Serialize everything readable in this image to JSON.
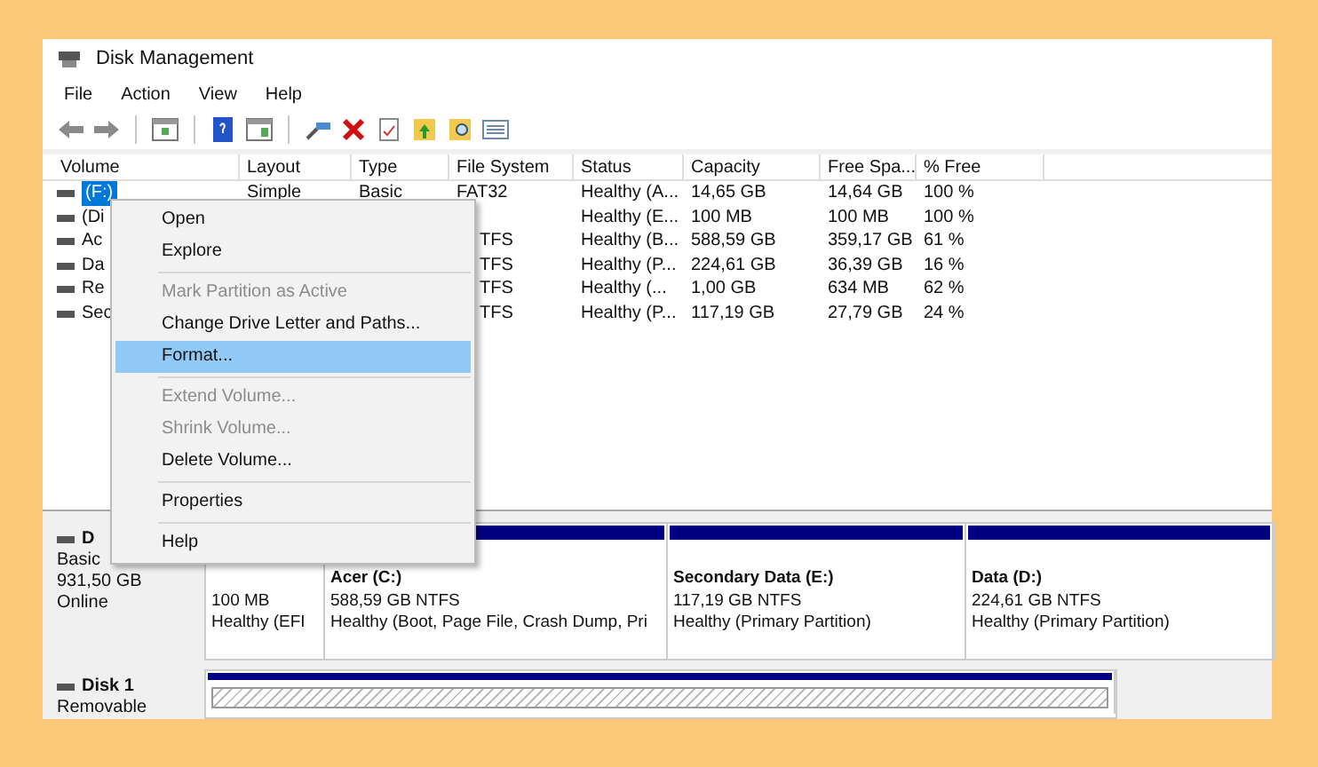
{
  "window": {
    "title": "Disk Management"
  },
  "menu_bar": [
    "File",
    "Action",
    "View",
    "Help"
  ],
  "table": {
    "columns": [
      "Volume",
      "Layout",
      "Type",
      "File System",
      "Status",
      "Capacity",
      "Free Spa...",
      "% Free"
    ],
    "rows": [
      {
        "selected": true,
        "cells": [
          "(F:)",
          "Simple",
          "Basic",
          "FAT32",
          "Healthy (A...",
          "14,65 GB",
          "14,64 GB",
          "100 %"
        ]
      },
      {
        "selected": false,
        "cells": [
          "(Di",
          "",
          "",
          "",
          "Healthy (E...",
          "100 MB",
          "100 MB",
          "100 %"
        ]
      },
      {
        "selected": false,
        "cells": [
          "Ac",
          "",
          "",
          "TFS",
          "Healthy (B...",
          "588,59 GB",
          "359,17 GB",
          "61 %"
        ]
      },
      {
        "selected": false,
        "cells": [
          "Da",
          "",
          "",
          "TFS",
          "Healthy (P...",
          "224,61 GB",
          "36,39 GB",
          "16 %"
        ]
      },
      {
        "selected": false,
        "cells": [
          "Re",
          "",
          "",
          "TFS",
          "Healthy (...",
          "1,00 GB",
          "634 MB",
          "62 %"
        ]
      },
      {
        "selected": false,
        "cells": [
          "Sec",
          "",
          "",
          "TFS",
          "Healthy (P...",
          "117,19 GB",
          "27,79 GB",
          "24 %"
        ]
      }
    ]
  },
  "context_menu": [
    {
      "kind": "item",
      "label": "Open",
      "disabled": false,
      "selected": false
    },
    {
      "kind": "item",
      "label": "Explore",
      "disabled": false,
      "selected": false
    },
    {
      "kind": "separator"
    },
    {
      "kind": "item",
      "label": "Mark Partition as Active",
      "disabled": true,
      "selected": false
    },
    {
      "kind": "item",
      "label": "Change Drive Letter and Paths...",
      "disabled": false,
      "selected": false
    },
    {
      "kind": "item",
      "label": "Format...",
      "disabled": false,
      "selected": true
    },
    {
      "kind": "separator"
    },
    {
      "kind": "item",
      "label": "Extend Volume...",
      "disabled": true,
      "selected": false
    },
    {
      "kind": "item",
      "label": "Shrink Volume...",
      "disabled": true,
      "selected": false
    },
    {
      "kind": "item",
      "label": "Delete Volume...",
      "disabled": false,
      "selected": false
    },
    {
      "kind": "separator"
    },
    {
      "kind": "item",
      "label": "Properties",
      "disabled": false,
      "selected": false
    },
    {
      "kind": "separator"
    },
    {
      "kind": "item",
      "label": "Help",
      "disabled": false,
      "selected": false
    }
  ],
  "disks": [
    {
      "name": "D",
      "lines": [
        "Basic",
        "931,50 GB",
        "Online"
      ],
      "partitions": [
        {
          "lines": [
            "100 MB",
            "Healthy (EFI"
          ],
          "hatched": false
        },
        {
          "title": "Acer  (C:)",
          "lines": [
            "588,59 GB NTFS",
            "Healthy (Boot, Page File, Crash Dump, Pri"
          ],
          "hatched": false
        },
        {
          "title": "Secondary Data  (E:)",
          "lines": [
            "117,19 GB NTFS",
            "Healthy (Primary Partition)"
          ],
          "hatched": false
        },
        {
          "title": "Data   (D:)",
          "lines": [
            "224,61 GB NTFS",
            "Healthy (Primary Partition)"
          ],
          "hatched": false
        }
      ]
    },
    {
      "name": "Disk 1",
      "lines": [
        "Removable"
      ],
      "partitions": [
        {
          "hatched": true
        }
      ]
    }
  ]
}
